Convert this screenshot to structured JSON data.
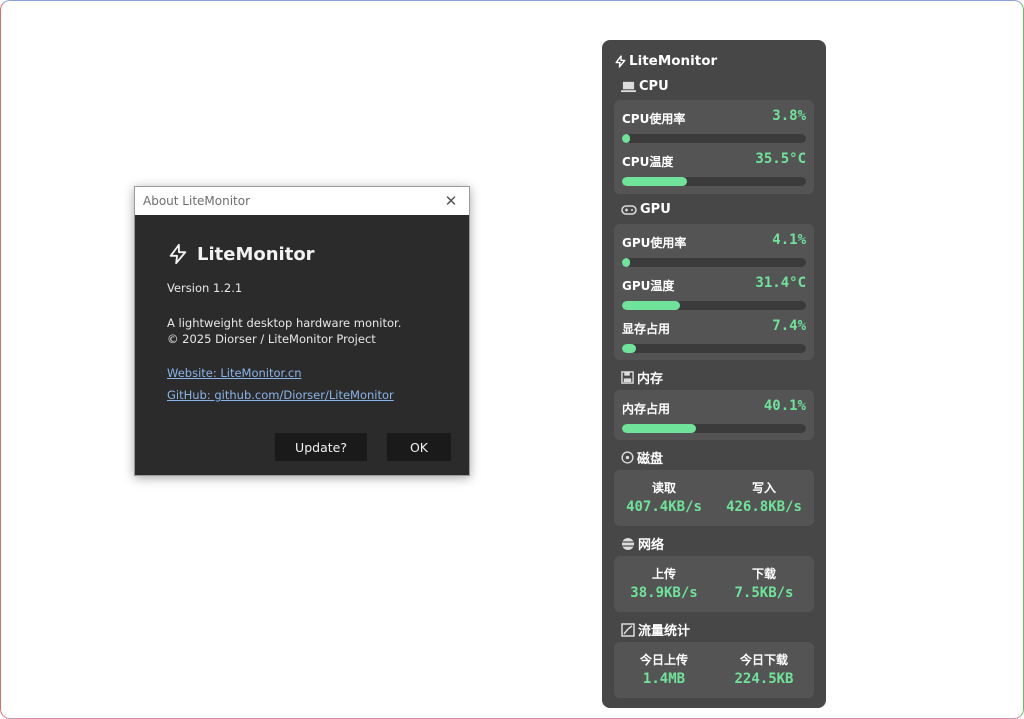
{
  "about": {
    "window_title": "About LiteMonitor",
    "app_name": "LiteMonitor",
    "version": "Version 1.2.1",
    "description": "A lightweight desktop hardware monitor.",
    "copyright": "© 2025 Diorser / LiteMonitor Project",
    "website": "Website: LiteMonitor.cn",
    "github": "GitHub: github.com/Diorser/LiteMonitor",
    "update_label": "Update?",
    "ok_label": "OK"
  },
  "monitor": {
    "title": "LiteMonitor",
    "accent": "#6fe39a",
    "cpu": {
      "title": "CPU",
      "usage": {
        "label": "CPU使用率",
        "value": "3.8%",
        "level": 0.038
      },
      "temp": {
        "label": "CPU温度",
        "value": "35.5°C",
        "level": 0.355
      }
    },
    "gpu": {
      "title": "GPU",
      "usage": {
        "label": "GPU使用率",
        "value": "4.1%",
        "level": 0.041
      },
      "temp": {
        "label": "GPU温度",
        "value": "31.4°C",
        "level": 0.314
      },
      "vram": {
        "label": "显存占用",
        "value": "7.4%",
        "level": 0.074
      }
    },
    "memory": {
      "title": "内存",
      "usage": {
        "label": "内存占用",
        "value": "40.1%",
        "level": 0.401
      }
    },
    "disk": {
      "title": "磁盘",
      "read_label": "读取",
      "read_value": "407.4KB/s",
      "write_label": "写入",
      "write_value": "426.8KB/s"
    },
    "network": {
      "title": "网络",
      "up_label": "上传",
      "up_value": "38.9KB/s",
      "down_label": "下载",
      "down_value": "7.5KB/s"
    },
    "traffic": {
      "title": "流量统计",
      "up_label": "今日上传",
      "up_value": "1.4MB",
      "down_label": "今日下载",
      "down_value": "224.5KB"
    }
  }
}
